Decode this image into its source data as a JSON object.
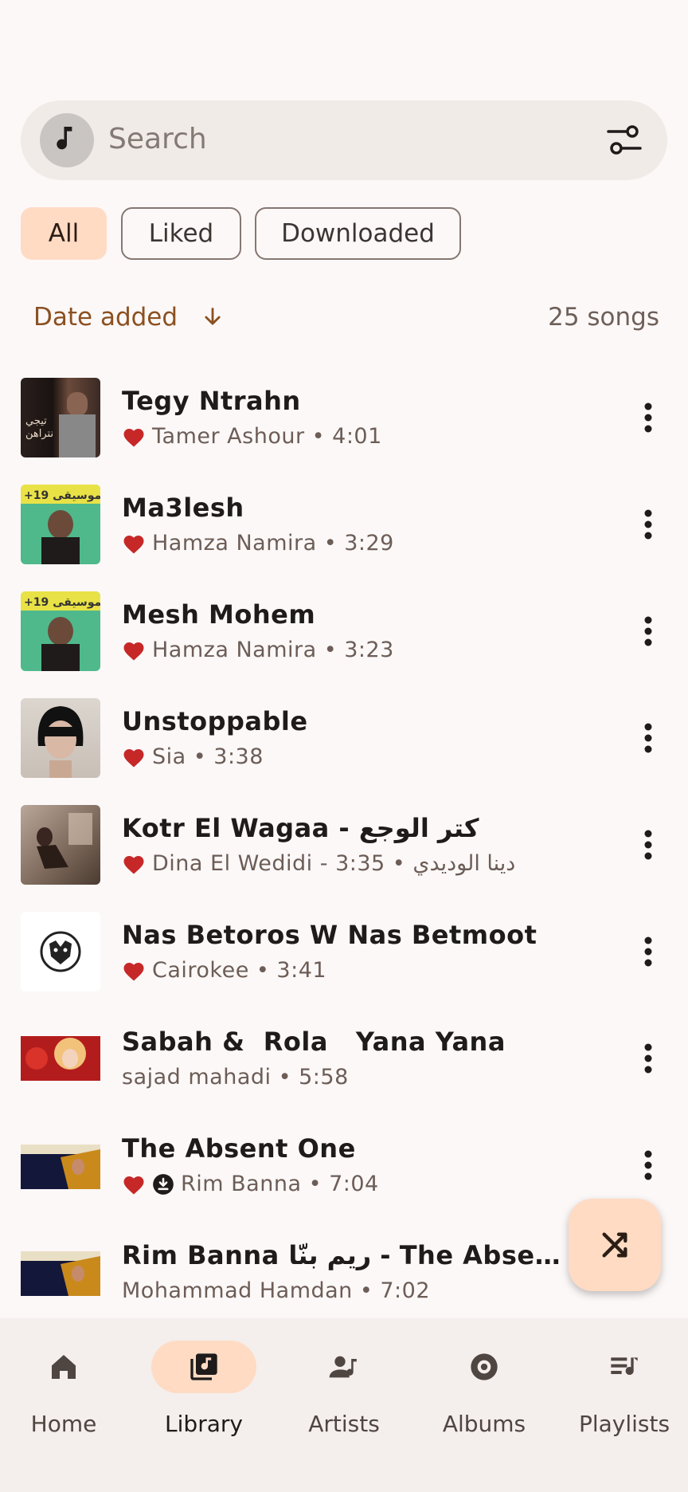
{
  "search": {
    "placeholder": "Search",
    "avatar_icon": "music-note-icon",
    "filter_icon": "tune-icon"
  },
  "chips": [
    {
      "label": "All",
      "selected": true
    },
    {
      "label": "Liked",
      "selected": false
    },
    {
      "label": "Downloaded",
      "selected": false
    }
  ],
  "sort": {
    "label": "Date added",
    "direction_icon": "arrow-down-icon"
  },
  "song_count": "25 songs",
  "songs": [
    {
      "title": "Tegy Ntrahn",
      "subtitle": "Tamer Ashour • 4:01",
      "liked": true,
      "downloaded": false
    },
    {
      "title": "Ma3lesh",
      "subtitle": "Hamza Namira • 3:29",
      "liked": true,
      "downloaded": false
    },
    {
      "title": "Mesh Mohem",
      "subtitle": "Hamza Namira • 3:23",
      "liked": true,
      "downloaded": false
    },
    {
      "title": "Unstoppable",
      "subtitle": "Sia • 3:38",
      "liked": true,
      "downloaded": false
    },
    {
      "title": "Kotr El Wagaa - كتر الوجع",
      "subtitle": "Dina El Wedidi - 3:35 • دينا الوديدي",
      "liked": true,
      "downloaded": false
    },
    {
      "title": "Nas Betoros W Nas Betmoot",
      "subtitle": "Cairokee • 3:41",
      "liked": true,
      "downloaded": false
    },
    {
      "title": "Sabah &  Rola   Yana Yana",
      "subtitle": "sajad mahadi • 5:58",
      "liked": false,
      "downloaded": false
    },
    {
      "title": "The Absent One",
      "subtitle": "Rim Banna • 7:04",
      "liked": true,
      "downloaded": true
    },
    {
      "title": "Rim Banna ريم بنّا  - The Absent One",
      "subtitle": "Mohammad Hamdan • 7:02",
      "liked": false,
      "downloaded": false
    }
  ],
  "fab_icon": "shuffle-icon",
  "nav": [
    {
      "label": "Home",
      "icon": "home-icon",
      "active": false
    },
    {
      "label": "Library",
      "icon": "library-music-icon",
      "active": true
    },
    {
      "label": "Artists",
      "icon": "artist-icon",
      "active": false
    },
    {
      "label": "Albums",
      "icon": "album-icon",
      "active": false
    },
    {
      "label": "Playlists",
      "icon": "playlist-icon",
      "active": false
    }
  ],
  "colors": {
    "accent": "#FFDBC4",
    "heart": "#C62828",
    "sort_text": "#8B5020",
    "background": "#FCF8F8"
  }
}
